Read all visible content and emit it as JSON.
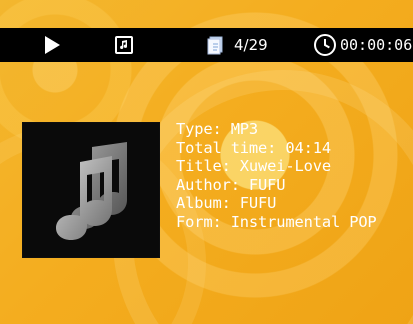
{
  "toolbar": {
    "play_icon": "play-icon",
    "mode_icon": "music-note-icon",
    "file_icon": "file-stack-icon",
    "file_count": "4/29",
    "clock_icon": "clock-icon",
    "elapsed_time": "00:00:06"
  },
  "track": {
    "cover_icon": "music-notes-icon",
    "type": "Type: MP3",
    "total_time": "Total time: 04:14",
    "title": "Title: Xuwei-Love",
    "author": "Author: FUFU",
    "album": "Album: FUFU",
    "form": "Form: Instrumental POP"
  },
  "colors": {
    "background": "#f3ad1d",
    "topbar": "#000000",
    "text": "#ffffff",
    "cover": "#0a0a0a"
  }
}
